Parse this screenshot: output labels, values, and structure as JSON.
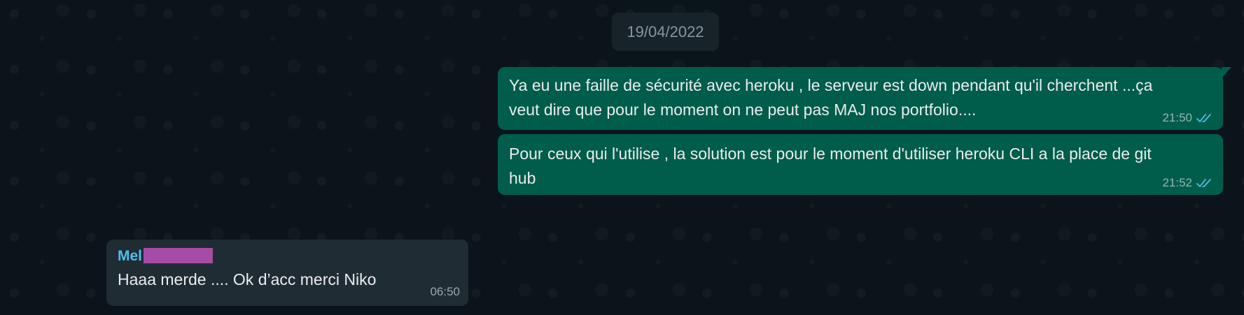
{
  "chat": {
    "date_separator": "19/04/2022",
    "messages": [
      {
        "direction": "outgoing",
        "text": "Ya eu une faille de sécurité avec heroku , le serveur est down pendant qu'il cherchent ...ça veut dire que pour le moment on ne peut pas MAJ nos portfolio....",
        "time": "21:50",
        "status_icon": "double-check-read-icon"
      },
      {
        "direction": "outgoing",
        "text": "Pour ceux qui l'utilise , la solution est pour le moment d'utiliser heroku CLI a la place de git hub",
        "time": "21:52",
        "status_icon": "double-check-read-icon"
      },
      {
        "direction": "incoming",
        "sender": "Mel",
        "text": "Haaa merde .... Ok d’acc merci Niko",
        "time": "06:50"
      }
    ]
  },
  "colors": {
    "background": "#0b141a",
    "outgoing_bubble": "#005c4b",
    "incoming_bubble": "#202c33",
    "date_chip": "#182229",
    "read_check": "#53bdeb",
    "sender_name": "#53bdeb",
    "redaction": "#a64ca6"
  }
}
